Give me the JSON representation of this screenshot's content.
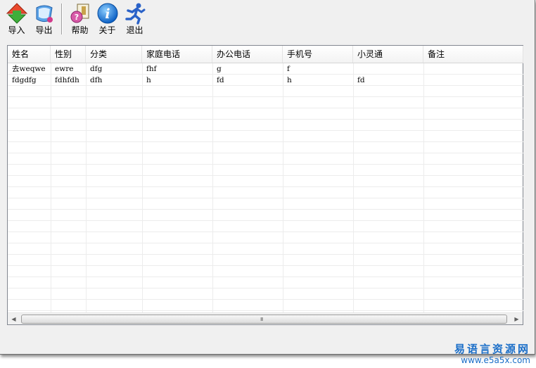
{
  "toolbar": {
    "import_label": "导入",
    "export_label": "导出",
    "help_label": "帮助",
    "about_label": "关于",
    "exit_label": "退出"
  },
  "table": {
    "columns": [
      "姓名",
      "性别",
      "分类",
      "家庭电话",
      "办公电话",
      "手机号",
      "小灵通",
      "备注"
    ],
    "rows": [
      [
        "去weqwe",
        "ewre",
        "dfg",
        "fhf",
        "g",
        "f",
        "",
        ""
      ],
      [
        "fdgdfg",
        "fdhfdh",
        "dfh",
        "h",
        "fd",
        "h",
        "fd",
        ""
      ]
    ]
  },
  "scrollbar": {
    "left_arrow": "◀",
    "right_arrow": "▶",
    "grip": "III"
  },
  "watermark": {
    "chinese": "易语言资源网",
    "url": "www.e5a5x.com"
  },
  "colors": {
    "watermark": "#1a6ec8",
    "grid_line": "#ececec"
  }
}
